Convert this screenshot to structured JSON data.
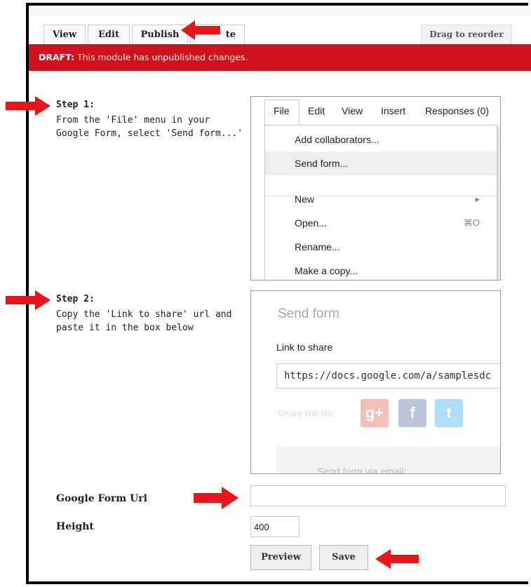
{
  "tabs": [
    {
      "label": "View"
    },
    {
      "label": "Edit"
    },
    {
      "label": "Publish"
    },
    {
      "label": "te"
    }
  ],
  "drag_label": "Drag to reorder",
  "draft": {
    "prefix": "DRAFT:",
    "message": " This module has unpublished changes."
  },
  "step1": {
    "title": "Step 1:",
    "text": "From the 'File' menu in your Google Form, select 'Send form...'"
  },
  "step2": {
    "title": "Step 2:",
    "text": "Copy the 'Link to share' url and paste it in the box below"
  },
  "file_menu": {
    "menubar": [
      "File",
      "Edit",
      "View",
      "Insert",
      "Responses (0)"
    ],
    "items": [
      {
        "label": "Add collaborators..."
      },
      {
        "label": "Send form..."
      },
      {
        "label": "New",
        "right": "▸"
      },
      {
        "label": "Open...",
        "right": "⌘O"
      },
      {
        "label": "Rename..."
      },
      {
        "label": "Make a copy..."
      }
    ]
  },
  "send_form": {
    "title": "Send form",
    "link_label": "Link to share",
    "url": "https://docs.google.com/a/samplesdc",
    "share_via": "Share link via:",
    "email": "Send form via email:"
  },
  "form": {
    "url_label": "Google Form Url",
    "url_value": "",
    "height_label": "Height",
    "height_value": "400"
  },
  "buttons": {
    "preview": "Preview",
    "save": "Save"
  },
  "colors": {
    "draft_bg": "#d0121d",
    "arrow": "#e8161c"
  }
}
